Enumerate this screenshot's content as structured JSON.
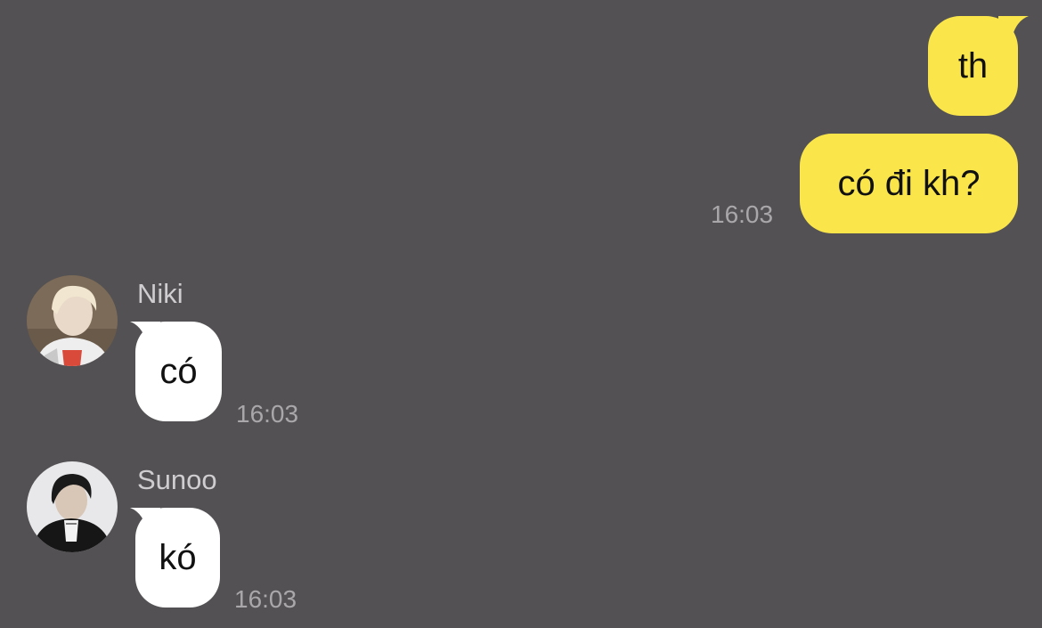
{
  "outgoing": [
    {
      "text": "th",
      "time": ""
    },
    {
      "text": "có đi kh?",
      "time": "16:03"
    }
  ],
  "incoming": [
    {
      "sender": "Niki",
      "text": "có",
      "time": "16:03",
      "avatar_icon": "profile-photo-niki"
    },
    {
      "sender": "Sunoo",
      "text": "kó",
      "time": "16:03",
      "avatar_icon": "profile-photo-sunoo"
    }
  ],
  "colors": {
    "background": "#535153",
    "outgoing_bubble": "#FAE64B",
    "incoming_bubble": "#FFFFFF",
    "timestamp": "#A9A7A9",
    "sender_name": "#CFCDCF"
  }
}
